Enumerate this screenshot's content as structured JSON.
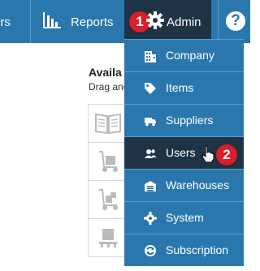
{
  "nav": {
    "suppliers_label": "ers",
    "reports_label": "Reports",
    "admin_label": "Admin",
    "admin_step_badge": "1",
    "help_label": "?"
  },
  "content": {
    "title": "Availa",
    "subtitle": "Drag and"
  },
  "admin_menu": {
    "items": [
      {
        "label": "Company",
        "icon": "building-icon"
      },
      {
        "label": "Items",
        "icon": "tag-icon"
      },
      {
        "label": "Suppliers",
        "icon": "truck-icon"
      },
      {
        "label": "Users",
        "icon": "users-icon",
        "active": true,
        "step_badge": "2"
      },
      {
        "label": "Warehouses",
        "icon": "warehouse-icon"
      },
      {
        "label": "System",
        "icon": "gear-icon"
      },
      {
        "label": "Subscription",
        "icon": "subscription-icon"
      }
    ]
  },
  "colors": {
    "nav_bg": "#2a77ad",
    "active_bg": "#1f3347",
    "badge": "#d7202a"
  }
}
